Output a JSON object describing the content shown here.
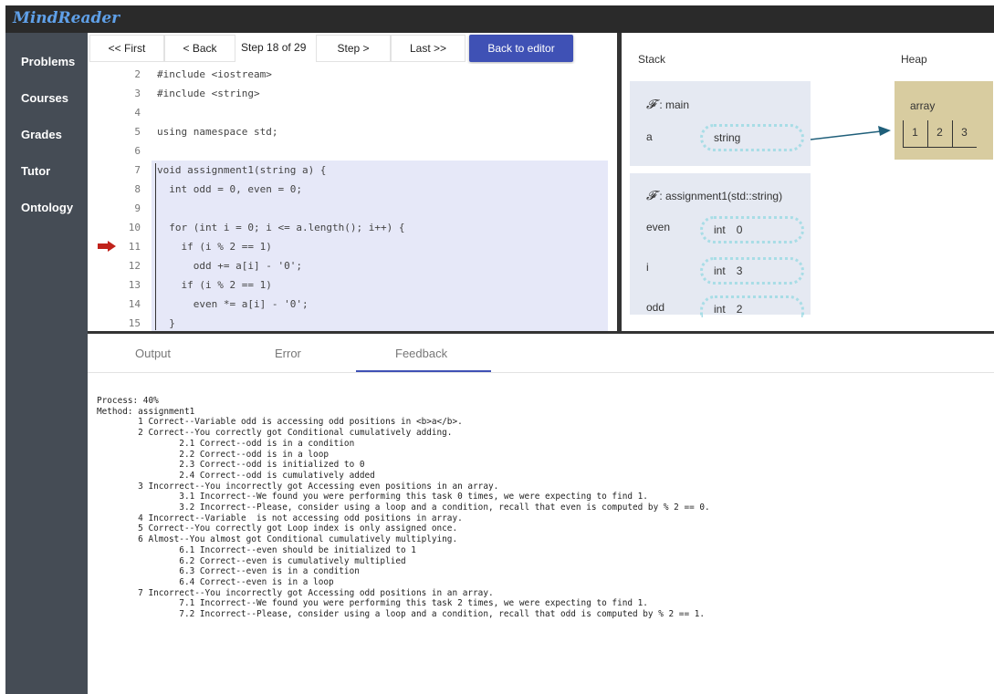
{
  "app": {
    "title": "MindReader"
  },
  "sidebar": {
    "items": [
      {
        "label": "Problems"
      },
      {
        "label": "Courses"
      },
      {
        "label": "Grades"
      },
      {
        "label": "Tutor"
      },
      {
        "label": "Ontology"
      }
    ]
  },
  "toolbar": {
    "first_label": "<< First",
    "back_label": "< Back",
    "step_indicator": "Step 18 of 29",
    "step_label": "Step >",
    "last_label": "Last >>",
    "editor_label": "Back to editor"
  },
  "code": {
    "current_line": 11,
    "lines": [
      {
        "num": "2",
        "text": "#include <iostream>",
        "highlight": false
      },
      {
        "num": "3",
        "text": "#include <string>",
        "highlight": false
      },
      {
        "num": "4",
        "text": "",
        "highlight": false
      },
      {
        "num": "5",
        "text": "using namespace std;",
        "highlight": false
      },
      {
        "num": "6",
        "text": "",
        "highlight": false
      },
      {
        "num": "7",
        "text": "void assignment1(string a) {",
        "highlight": true
      },
      {
        "num": "8",
        "text": "  int odd = 0, even = 0;",
        "highlight": true
      },
      {
        "num": "9",
        "text": "",
        "highlight": true
      },
      {
        "num": "10",
        "text": "  for (int i = 0; i <= a.length(); i++) {",
        "highlight": true
      },
      {
        "num": "11",
        "text": "    if (i % 2 == 1)",
        "highlight": true
      },
      {
        "num": "12",
        "text": "      odd += a[i] - '0';",
        "highlight": true
      },
      {
        "num": "13",
        "text": "    if (i % 2 == 1)",
        "highlight": true
      },
      {
        "num": "14",
        "text": "      even *= a[i] - '0';",
        "highlight": true
      },
      {
        "num": "15",
        "text": "  }",
        "highlight": true
      }
    ]
  },
  "memory": {
    "stack_title": "Stack",
    "heap_title": "Heap",
    "frames": [
      {
        "symbol": "𝓕",
        "name": ": main",
        "vars": [
          {
            "name": "a",
            "type": "string",
            "value": ""
          }
        ]
      },
      {
        "symbol": "𝓕",
        "name": ": assignment1(std::string)",
        "vars": [
          {
            "name": "even",
            "type": "int",
            "value": "0"
          },
          {
            "name": "i",
            "type": "int",
            "value": "3"
          },
          {
            "name": "odd",
            "type": "int",
            "value": "2"
          }
        ]
      }
    ],
    "heap": {
      "label": "array",
      "cells": [
        "1",
        "2",
        "3"
      ]
    },
    "colors": {
      "frame": "#e5e9f2",
      "heap": "#d8cca0",
      "pointer": "#1f5f7a",
      "var_border": "#a8dde6"
    }
  },
  "tabs": [
    {
      "label": "Output",
      "active": false
    },
    {
      "label": "Error",
      "active": false
    },
    {
      "label": "Feedback",
      "active": true
    }
  ],
  "feedback": {
    "lines": [
      "Process: 40%",
      "Method: assignment1",
      "        1 Correct--Variable odd is accessing odd positions in <b>a</b>.",
      "        2 Correct--You correctly got Conditional cumulatively adding.",
      "                2.1 Correct--odd is in a condition",
      "                2.2 Correct--odd is in a loop",
      "                2.3 Correct--odd is initialized to 0",
      "                2.4 Correct--odd is cumulatively added",
      "        3 Incorrect--You incorrectly got Accessing even positions in an array.",
      "                3.1 Incorrect--We found you were performing this task 0 times, we were expecting to find 1.",
      "                3.2 Incorrect--Please, consider using a loop and a condition, recall that even is computed by % 2 == 0.",
      "        4 Incorrect--Variable  is not accessing odd positions in array.",
      "        5 Correct--You correctly got Loop index is only assigned once.",
      "        6 Almost--You almost got Conditional cumulatively multiplying.",
      "                6.1 Incorrect--even should be initialized to 1",
      "                6.2 Correct--even is cumulatively multiplied",
      "                6.3 Correct--even is in a condition",
      "                6.4 Correct--even is in a loop",
      "        7 Incorrect--You incorrectly got Accessing odd positions in an array.",
      "                7.1 Incorrect--We found you were performing this task 2 times, we were expecting to find 1.",
      "                7.2 Incorrect--Please, consider using a loop and a condition, recall that odd is computed by % 2 == 1."
    ]
  }
}
